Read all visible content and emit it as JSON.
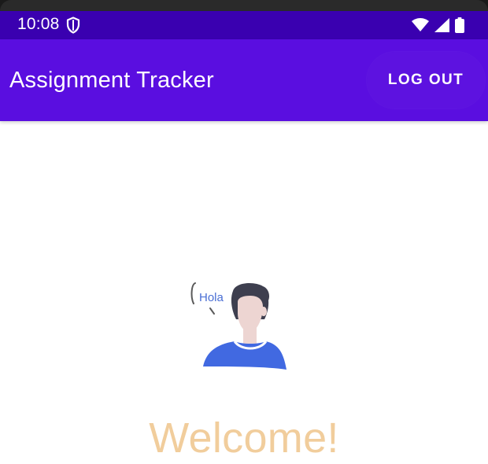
{
  "status_bar": {
    "time": "10:08",
    "shield_icon": "shield-icon",
    "wifi_icon": "wifi-icon",
    "signal_icon": "signal-icon",
    "battery_icon": "battery-icon"
  },
  "app_bar": {
    "title": "Assignment Tracker",
    "logout_label": "LOG OUT"
  },
  "illustration": {
    "speech_text": "Hola"
  },
  "main": {
    "welcome_text": "Welcome!"
  },
  "colors": {
    "status_bar": "#3a00b0",
    "app_bar": "#5a0ee0",
    "welcome": "#f1cd9c",
    "shirt": "#4169e1",
    "hair": "#3e3f4f",
    "skin": "#edd5d2"
  }
}
